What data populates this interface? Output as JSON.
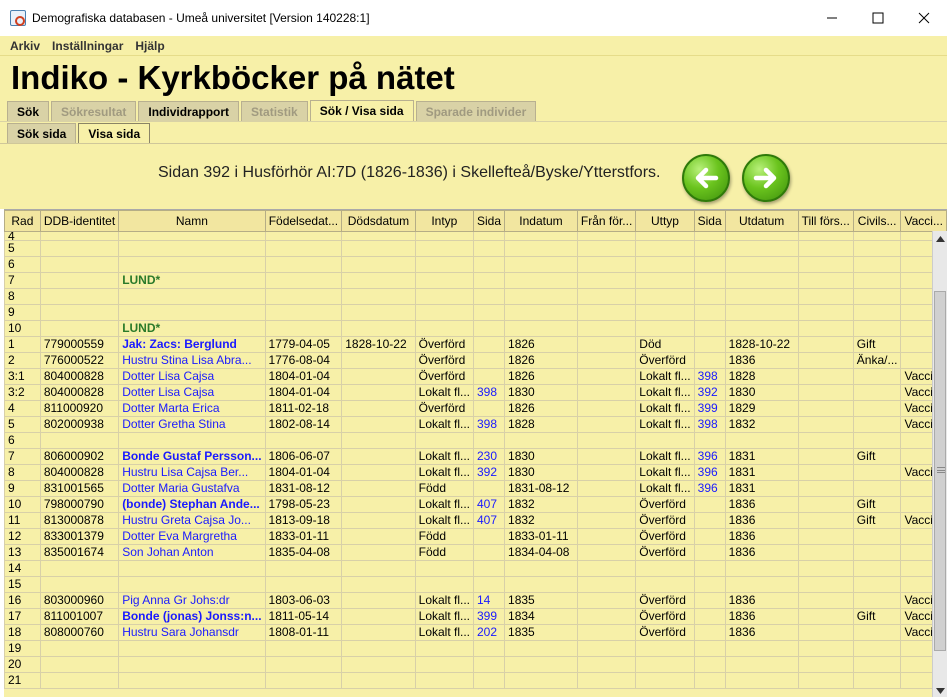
{
  "window": {
    "title": "Demografiska databasen - Umeå universitet   [Version 140228:1]"
  },
  "menu": [
    "Arkiv",
    "Inställningar",
    "Hjälp"
  ],
  "banner": {
    "title": "Indiko - Kyrkböcker på nätet"
  },
  "tabs": [
    {
      "label": "Sök",
      "state": "enabled"
    },
    {
      "label": "Sökresultat",
      "state": "disabled"
    },
    {
      "label": "Individrapport",
      "state": "enabled"
    },
    {
      "label": "Statistik",
      "state": "disabled"
    },
    {
      "label": "Sök / Visa sida",
      "state": "active"
    },
    {
      "label": "Sparade individer",
      "state": "disabled"
    }
  ],
  "subtabs": [
    {
      "label": "Sök sida",
      "state": "enabled"
    },
    {
      "label": "Visa sida",
      "state": "active"
    }
  ],
  "page_info": "Sidan 392 i Husförhör AI:7D (1826-1836) i Skellefteå/Byske/Ytterstfors.",
  "icons": {
    "prev": "arrow-left-icon",
    "next": "arrow-right-icon"
  },
  "colors": {
    "background": "#f7f0a8",
    "link": "#1a1aff",
    "label_green": "#2a7a2a",
    "nav_green": "#6bc41e"
  },
  "table": {
    "columns": [
      "Rad",
      "DDB-identitet",
      "Namn",
      "Födelsedat...",
      "Dödsdatum",
      "Intyp",
      "Sida",
      "Indatum",
      "Från för...",
      "Uttyp",
      "Sida",
      "Utdatum",
      "Till förs...",
      "Civils...",
      "Vacci..."
    ],
    "rows": [
      {
        "rad": "4",
        "id": "",
        "namn": "",
        "style": "",
        "fodd": "",
        "dod": "",
        "intyp": "",
        "sida_in": "",
        "indatum": "",
        "fran": "",
        "uttyp": "",
        "sida_ut": "",
        "utdatum": "",
        "till": "",
        "civil": "",
        "vacc": ""
      },
      {
        "rad": "5",
        "id": "",
        "namn": "",
        "style": "",
        "fodd": "",
        "dod": "",
        "intyp": "",
        "sida_in": "",
        "indatum": "",
        "fran": "",
        "uttyp": "",
        "sida_ut": "",
        "utdatum": "",
        "till": "",
        "civil": "",
        "vacc": ""
      },
      {
        "rad": "6",
        "id": "",
        "namn": "",
        "style": "",
        "fodd": "",
        "dod": "",
        "intyp": "",
        "sida_in": "",
        "indatum": "",
        "fran": "",
        "uttyp": "",
        "sida_ut": "",
        "utdatum": "",
        "till": "",
        "civil": "",
        "vacc": ""
      },
      {
        "rad": "7",
        "id": "",
        "namn": "LUND*",
        "style": "green",
        "fodd": "",
        "dod": "",
        "intyp": "",
        "sida_in": "",
        "indatum": "",
        "fran": "",
        "uttyp": "",
        "sida_ut": "",
        "utdatum": "",
        "till": "",
        "civil": "",
        "vacc": ""
      },
      {
        "rad": "8",
        "id": "",
        "namn": "",
        "style": "",
        "fodd": "",
        "dod": "",
        "intyp": "",
        "sida_in": "",
        "indatum": "",
        "fran": "",
        "uttyp": "",
        "sida_ut": "",
        "utdatum": "",
        "till": "",
        "civil": "",
        "vacc": ""
      },
      {
        "rad": "9",
        "id": "",
        "namn": "",
        "style": "",
        "fodd": "",
        "dod": "",
        "intyp": "",
        "sida_in": "",
        "indatum": "",
        "fran": "",
        "uttyp": "",
        "sida_ut": "",
        "utdatum": "",
        "till": "",
        "civil": "",
        "vacc": ""
      },
      {
        "rad": "10",
        "id": "",
        "namn": "LUND*",
        "style": "green",
        "fodd": "",
        "dod": "",
        "intyp": "",
        "sida_in": "",
        "indatum": "",
        "fran": "",
        "uttyp": "",
        "sida_ut": "",
        "utdatum": "",
        "till": "",
        "civil": "",
        "vacc": ""
      },
      {
        "rad": "1",
        "id": "779000559",
        "namn": "Jak: Zacs: Berglund",
        "style": "bold",
        "fodd": "1779-04-05",
        "dod": "1828-10-22",
        "intyp": "Överförd",
        "sida_in": "",
        "indatum": "1826",
        "fran": "",
        "uttyp": "Död",
        "sida_ut": "",
        "utdatum": "1828-10-22",
        "till": "",
        "civil": "Gift",
        "vacc": ""
      },
      {
        "rad": "2",
        "id": "776000522",
        "namn": "Hustru Stina Lisa Abra...",
        "style": "normal",
        "fodd": "1776-08-04",
        "dod": "",
        "intyp": "Överförd",
        "sida_in": "",
        "indatum": "1826",
        "fran": "",
        "uttyp": "Överförd",
        "sida_ut": "",
        "utdatum": "1836",
        "till": "",
        "civil": "Änka/...",
        "vacc": ""
      },
      {
        "rad": "3:1",
        "id": "804000828",
        "namn": "Dotter Lisa Cajsa",
        "style": "normal",
        "fodd": "1804-01-04",
        "dod": "",
        "intyp": "Överförd",
        "sida_in": "",
        "indatum": "1826",
        "fran": "",
        "uttyp": "Lokalt fl...",
        "sida_ut": "398",
        "utdatum": "1828",
        "till": "",
        "civil": "",
        "vacc": "Vacci..."
      },
      {
        "rad": "3:2",
        "id": "804000828",
        "namn": "Dotter Lisa Cajsa",
        "style": "normal",
        "fodd": "1804-01-04",
        "dod": "",
        "intyp": "Lokalt fl...",
        "sida_in": "398",
        "indatum": "1830",
        "fran": "",
        "uttyp": "Lokalt fl...",
        "sida_ut": "392",
        "utdatum": "1830",
        "till": "",
        "civil": "",
        "vacc": "Vacci..."
      },
      {
        "rad": "4",
        "id": "811000920",
        "namn": "Dotter Marta Erica",
        "style": "normal",
        "fodd": "1811-02-18",
        "dod": "",
        "intyp": "Överförd",
        "sida_in": "",
        "indatum": "1826",
        "fran": "",
        "uttyp": "Lokalt fl...",
        "sida_ut": "399",
        "utdatum": "1829",
        "till": "",
        "civil": "",
        "vacc": "Vacci..."
      },
      {
        "rad": "5",
        "id": "802000938",
        "namn": "Dotter Gretha Stina",
        "style": "normal",
        "fodd": "1802-08-14",
        "dod": "",
        "intyp": "Lokalt fl...",
        "sida_in": "398",
        "indatum": "1828",
        "fran": "",
        "uttyp": "Lokalt fl...",
        "sida_ut": "398",
        "utdatum": "1832",
        "till": "",
        "civil": "",
        "vacc": "Vacci..."
      },
      {
        "rad": "6",
        "id": "",
        "namn": "",
        "style": "",
        "fodd": "",
        "dod": "",
        "intyp": "",
        "sida_in": "",
        "indatum": "",
        "fran": "",
        "uttyp": "",
        "sida_ut": "",
        "utdatum": "",
        "till": "",
        "civil": "",
        "vacc": ""
      },
      {
        "rad": "7",
        "id": "806000902",
        "namn": "Bonde Gustaf Persson...",
        "style": "bold",
        "fodd": "1806-06-07",
        "dod": "",
        "intyp": "Lokalt fl...",
        "sida_in": "230",
        "indatum": "1830",
        "fran": "",
        "uttyp": "Lokalt fl...",
        "sida_ut": "396",
        "utdatum": "1831",
        "till": "",
        "civil": "Gift",
        "vacc": ""
      },
      {
        "rad": "8",
        "id": "804000828",
        "namn": "Hustru Lisa Cajsa Ber...",
        "style": "normal",
        "fodd": "1804-01-04",
        "dod": "",
        "intyp": "Lokalt fl...",
        "sida_in": "392",
        "indatum": "1830",
        "fran": "",
        "uttyp": "Lokalt fl...",
        "sida_ut": "396",
        "utdatum": "1831",
        "till": "",
        "civil": "",
        "vacc": "Vacci..."
      },
      {
        "rad": "9",
        "id": "831001565",
        "namn": "Dotter Maria Gustafva",
        "style": "normal",
        "fodd": "1831-08-12",
        "dod": "",
        "intyp": "Född",
        "sida_in": "",
        "indatum": "1831-08-12",
        "fran": "",
        "uttyp": "Lokalt fl...",
        "sida_ut": "396",
        "utdatum": "1831",
        "till": "",
        "civil": "",
        "vacc": ""
      },
      {
        "rad": "10",
        "id": "798000790",
        "namn": "(bonde) Stephan Ande...",
        "style": "bold",
        "fodd": "1798-05-23",
        "dod": "",
        "intyp": "Lokalt fl...",
        "sida_in": "407",
        "indatum": "1832",
        "fran": "",
        "uttyp": "Överförd",
        "sida_ut": "",
        "utdatum": "1836",
        "till": "",
        "civil": "Gift",
        "vacc": ""
      },
      {
        "rad": "11",
        "id": "813000878",
        "namn": "Hustru Greta Cajsa Jo...",
        "style": "normal",
        "fodd": "1813-09-18",
        "dod": "",
        "intyp": "Lokalt fl...",
        "sida_in": "407",
        "indatum": "1832",
        "fran": "",
        "uttyp": "Överförd",
        "sida_ut": "",
        "utdatum": "1836",
        "till": "",
        "civil": "Gift",
        "vacc": "Vacci..."
      },
      {
        "rad": "12",
        "id": "833001379",
        "namn": "Dotter Eva Margretha",
        "style": "normal",
        "fodd": "1833-01-11",
        "dod": "",
        "intyp": "Född",
        "sida_in": "",
        "indatum": "1833-01-11",
        "fran": "",
        "uttyp": "Överförd",
        "sida_ut": "",
        "utdatum": "1836",
        "till": "",
        "civil": "",
        "vacc": ""
      },
      {
        "rad": "13",
        "id": "835001674",
        "namn": "Son Johan Anton",
        "style": "normal",
        "fodd": "1835-04-08",
        "dod": "",
        "intyp": "Född",
        "sida_in": "",
        "indatum": "1834-04-08",
        "fran": "",
        "uttyp": "Överförd",
        "sida_ut": "",
        "utdatum": "1836",
        "till": "",
        "civil": "",
        "vacc": ""
      },
      {
        "rad": "14",
        "id": "",
        "namn": "",
        "style": "",
        "fodd": "",
        "dod": "",
        "intyp": "",
        "sida_in": "",
        "indatum": "",
        "fran": "",
        "uttyp": "",
        "sida_ut": "",
        "utdatum": "",
        "till": "",
        "civil": "",
        "vacc": ""
      },
      {
        "rad": "15",
        "id": "",
        "namn": "",
        "style": "",
        "fodd": "",
        "dod": "",
        "intyp": "",
        "sida_in": "",
        "indatum": "",
        "fran": "",
        "uttyp": "",
        "sida_ut": "",
        "utdatum": "",
        "till": "",
        "civil": "",
        "vacc": ""
      },
      {
        "rad": "16",
        "id": "803000960",
        "namn": "Pig Anna Gr Johs:dr",
        "style": "normal",
        "fodd": "1803-06-03",
        "dod": "",
        "intyp": "Lokalt fl...",
        "sida_in": "14",
        "indatum": "1835",
        "fran": "",
        "uttyp": "Överförd",
        "sida_ut": "",
        "utdatum": "1836",
        "till": "",
        "civil": "",
        "vacc": "Vacci..."
      },
      {
        "rad": "17",
        "id": "811001007",
        "namn": "Bonde (jonas) Jonss:n...",
        "style": "bold",
        "fodd": "1811-05-14",
        "dod": "",
        "intyp": "Lokalt fl...",
        "sida_in": "399",
        "indatum": "1834",
        "fran": "",
        "uttyp": "Överförd",
        "sida_ut": "",
        "utdatum": "1836",
        "till": "",
        "civil": "Gift",
        "vacc": "Vacci..."
      },
      {
        "rad": "18",
        "id": "808000760",
        "namn": "Hustru Sara Johansdr",
        "style": "normal",
        "fodd": "1808-01-11",
        "dod": "",
        "intyp": "Lokalt fl...",
        "sida_in": "202",
        "indatum": "1835",
        "fran": "",
        "uttyp": "Överförd",
        "sida_ut": "",
        "utdatum": "1836",
        "till": "",
        "civil": "",
        "vacc": "Vacci..."
      },
      {
        "rad": "19",
        "id": "",
        "namn": "",
        "style": "",
        "fodd": "",
        "dod": "",
        "intyp": "",
        "sida_in": "",
        "indatum": "",
        "fran": "",
        "uttyp": "",
        "sida_ut": "",
        "utdatum": "",
        "till": "",
        "civil": "",
        "vacc": ""
      },
      {
        "rad": "20",
        "id": "",
        "namn": "",
        "style": "",
        "fodd": "",
        "dod": "",
        "intyp": "",
        "sida_in": "",
        "indatum": "",
        "fran": "",
        "uttyp": "",
        "sida_ut": "",
        "utdatum": "",
        "till": "",
        "civil": "",
        "vacc": ""
      },
      {
        "rad": "21",
        "id": "",
        "namn": "",
        "style": "",
        "fodd": "",
        "dod": "",
        "intyp": "",
        "sida_in": "",
        "indatum": "",
        "fran": "",
        "uttyp": "",
        "sida_ut": "",
        "utdatum": "",
        "till": "",
        "civil": "",
        "vacc": ""
      }
    ]
  }
}
